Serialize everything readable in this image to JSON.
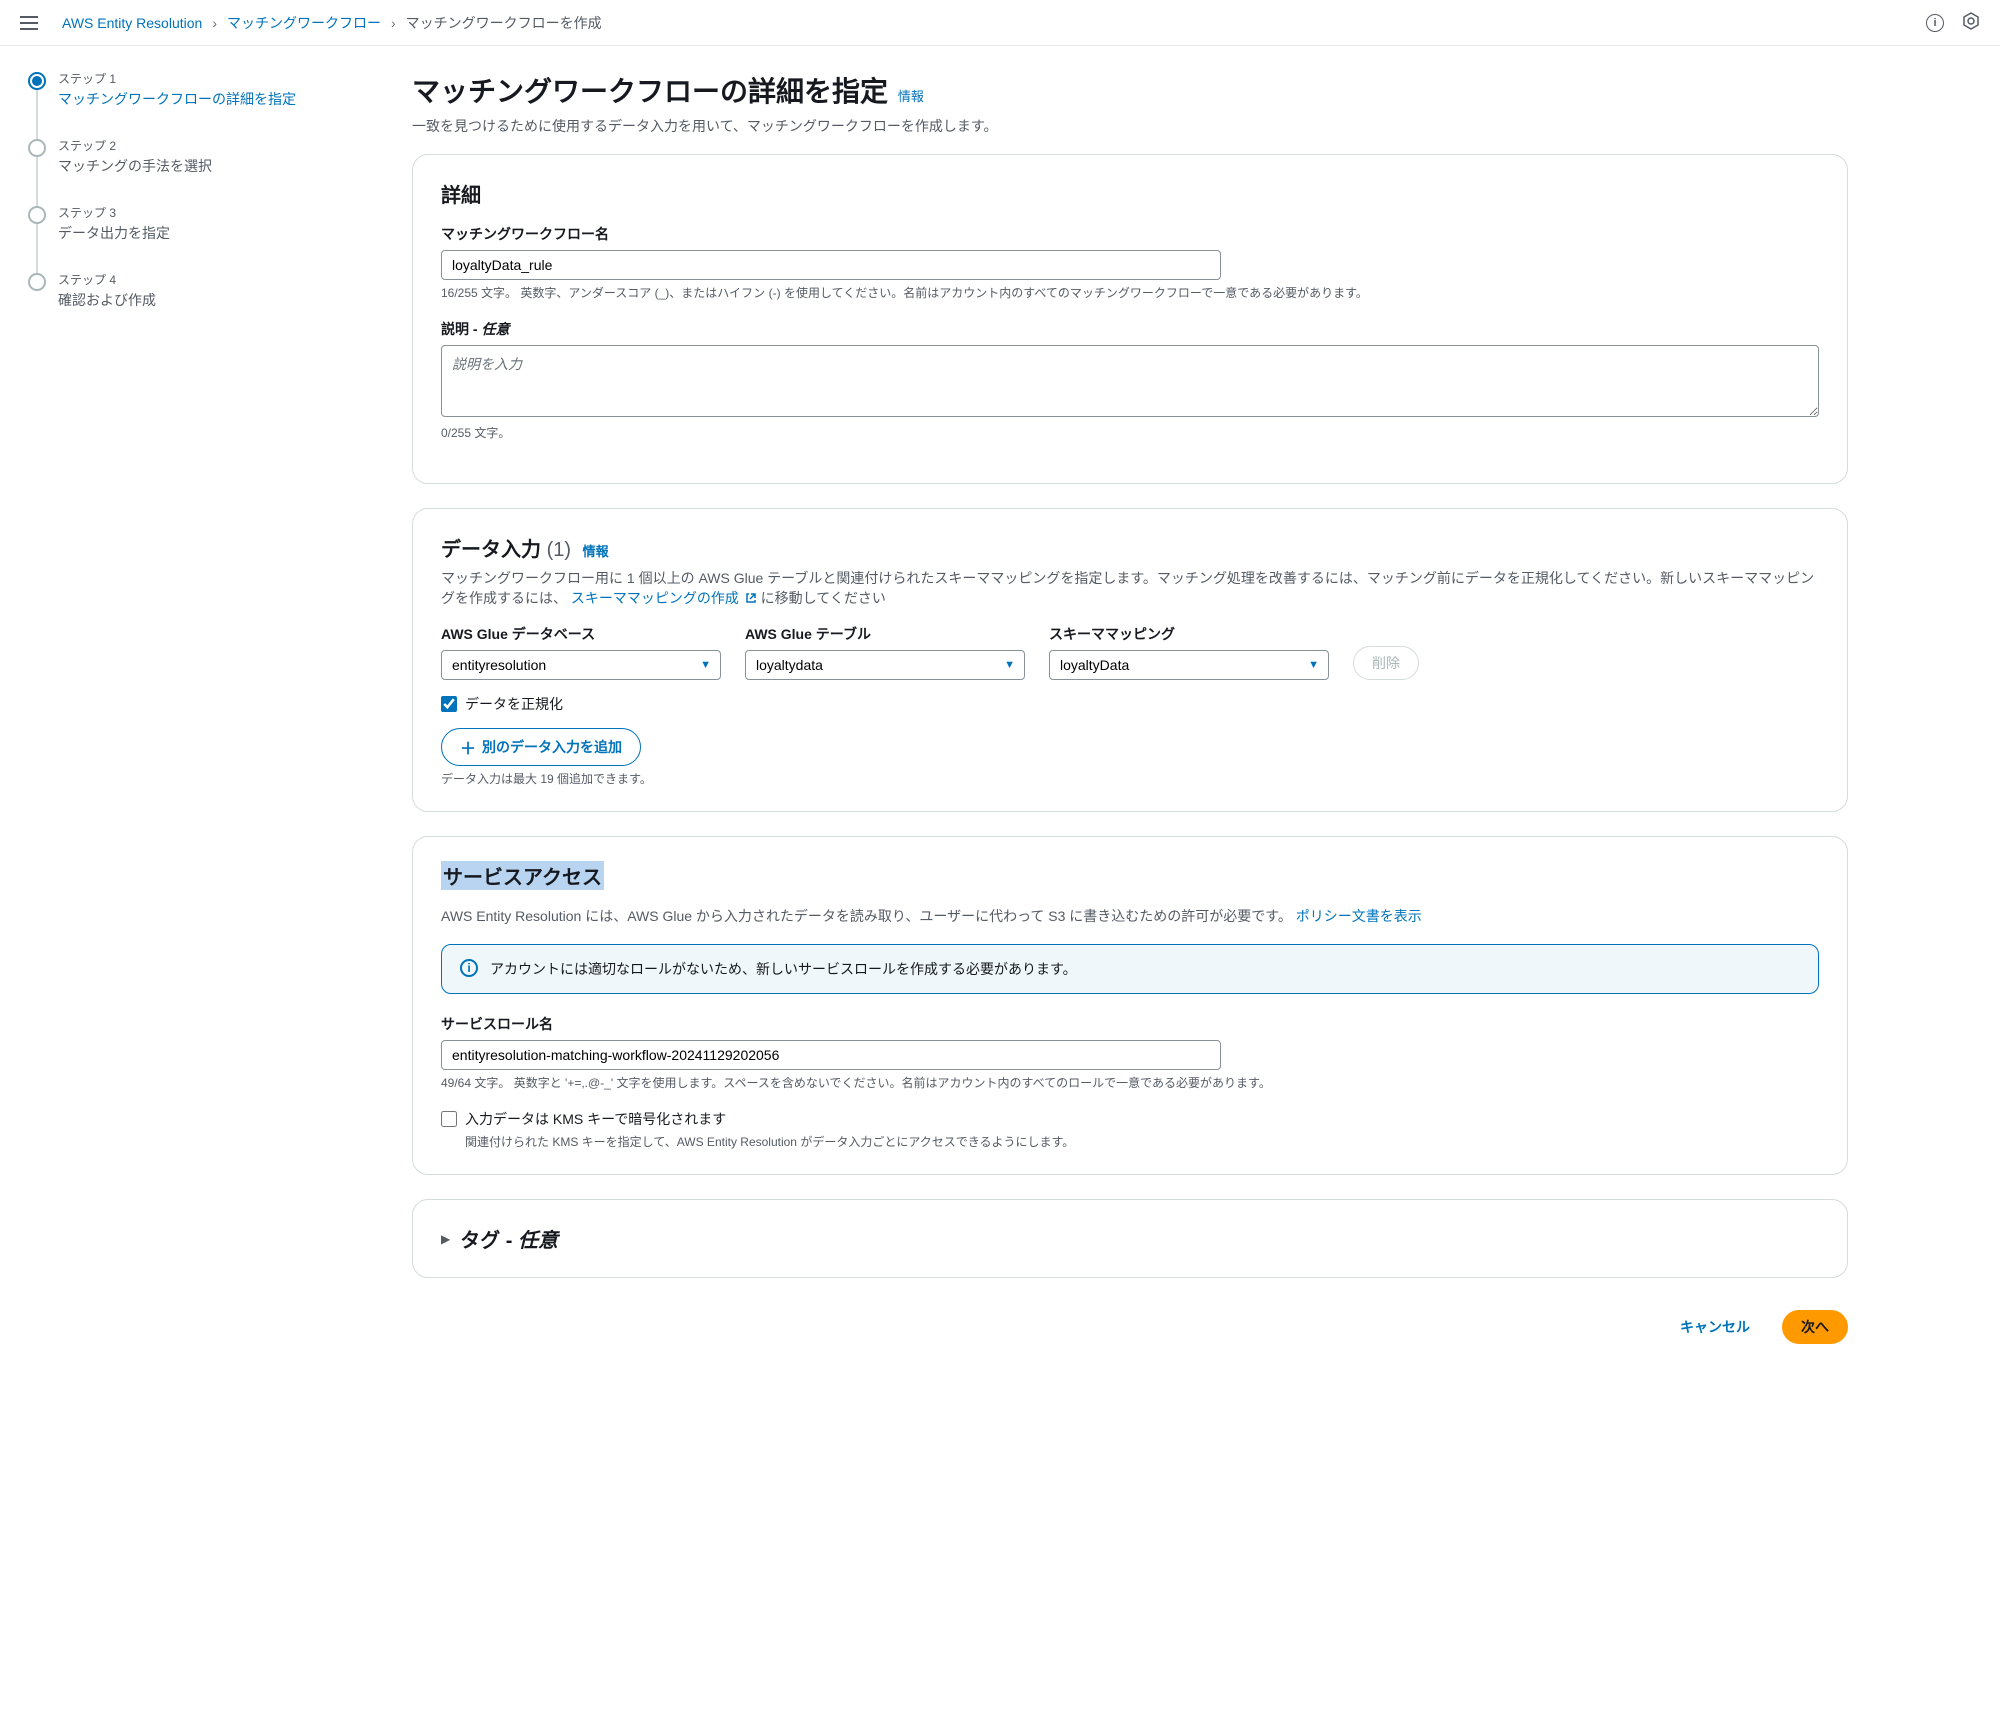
{
  "breadcrumb": {
    "root": "AWS Entity Resolution",
    "parent": "マッチングワークフロー",
    "current": "マッチングワークフローを作成"
  },
  "steps": [
    {
      "num": "ステップ 1",
      "title": "マッチングワークフローの詳細を指定"
    },
    {
      "num": "ステップ 2",
      "title": "マッチングの手法を選択"
    },
    {
      "num": "ステップ 3",
      "title": "データ出力を指定"
    },
    {
      "num": "ステップ 4",
      "title": "確認および作成"
    }
  ],
  "page": {
    "title": "マッチングワークフローの詳細を指定",
    "info": "情報",
    "desc": "一致を見つけるために使用するデータ入力を用いて、マッチングワークフローを作成します。"
  },
  "details": {
    "heading": "詳細",
    "name_label": "マッチングワークフロー名",
    "name_value": "loyaltyData_rule",
    "name_hint": "16/255 文字。 英数字、アンダースコア (_)、またはハイフン (-) を使用してください。名前はアカウント内のすべてのマッチングワークフローで一意である必要があります。",
    "desc_label": "説明",
    "optional": "任意",
    "desc_placeholder": "説明を入力",
    "desc_hint": "0/255 文字。"
  },
  "dataInput": {
    "heading_base": "データ入力",
    "count": "(1)",
    "info": "情報",
    "desc_pre": "マッチングワークフロー用に 1 個以上の AWS Glue テーブルと関連付けられたスキーママッピングを指定します。マッチング処理を改善するには、マッチング前にデータを正規化してください。新しいスキーママッピングを作成するには、",
    "link": "スキーママッピングの作成",
    "desc_post": "に移動してください",
    "db_label": "AWS Glue データベース",
    "db_value": "entityresolution",
    "table_label": "AWS Glue テーブル",
    "table_value": "loyaltydata",
    "schema_label": "スキーママッピング",
    "schema_value": "loyaltyData",
    "delete_btn": "削除",
    "normalize": "データを正規化",
    "add_btn": "別のデータ入力を追加",
    "add_hint": "データ入力は最大 19 個追加できます。"
  },
  "serviceAccess": {
    "heading": "サービスアクセス",
    "desc": "AWS Entity Resolution には、AWS Glue から入力されたデータを読み取り、ユーザーに代わって S3 に書き込むための許可が必要です。",
    "policy_link": "ポリシー文書を表示",
    "alert": "アカウントには適切なロールがないため、新しいサービスロールを作成する必要があります。",
    "role_label": "サービスロール名",
    "role_value": "entityresolution-matching-workflow-20241129202056",
    "role_hint": "49/64 文字。 英数字と '+=,.@-_' 文字を使用します。スペースを含めないでください。名前はアカウント内のすべてのロールで一意である必要があります。",
    "kms_label": "入力データは KMS キーで暗号化されます",
    "kms_hint": "関連付けられた KMS キーを指定して、AWS Entity Resolution がデータ入力ごとにアクセスできるようにします。"
  },
  "tags": {
    "heading": "タグ - ",
    "optional": "任意"
  },
  "footer": {
    "cancel": "キャンセル",
    "next": "次へ"
  }
}
